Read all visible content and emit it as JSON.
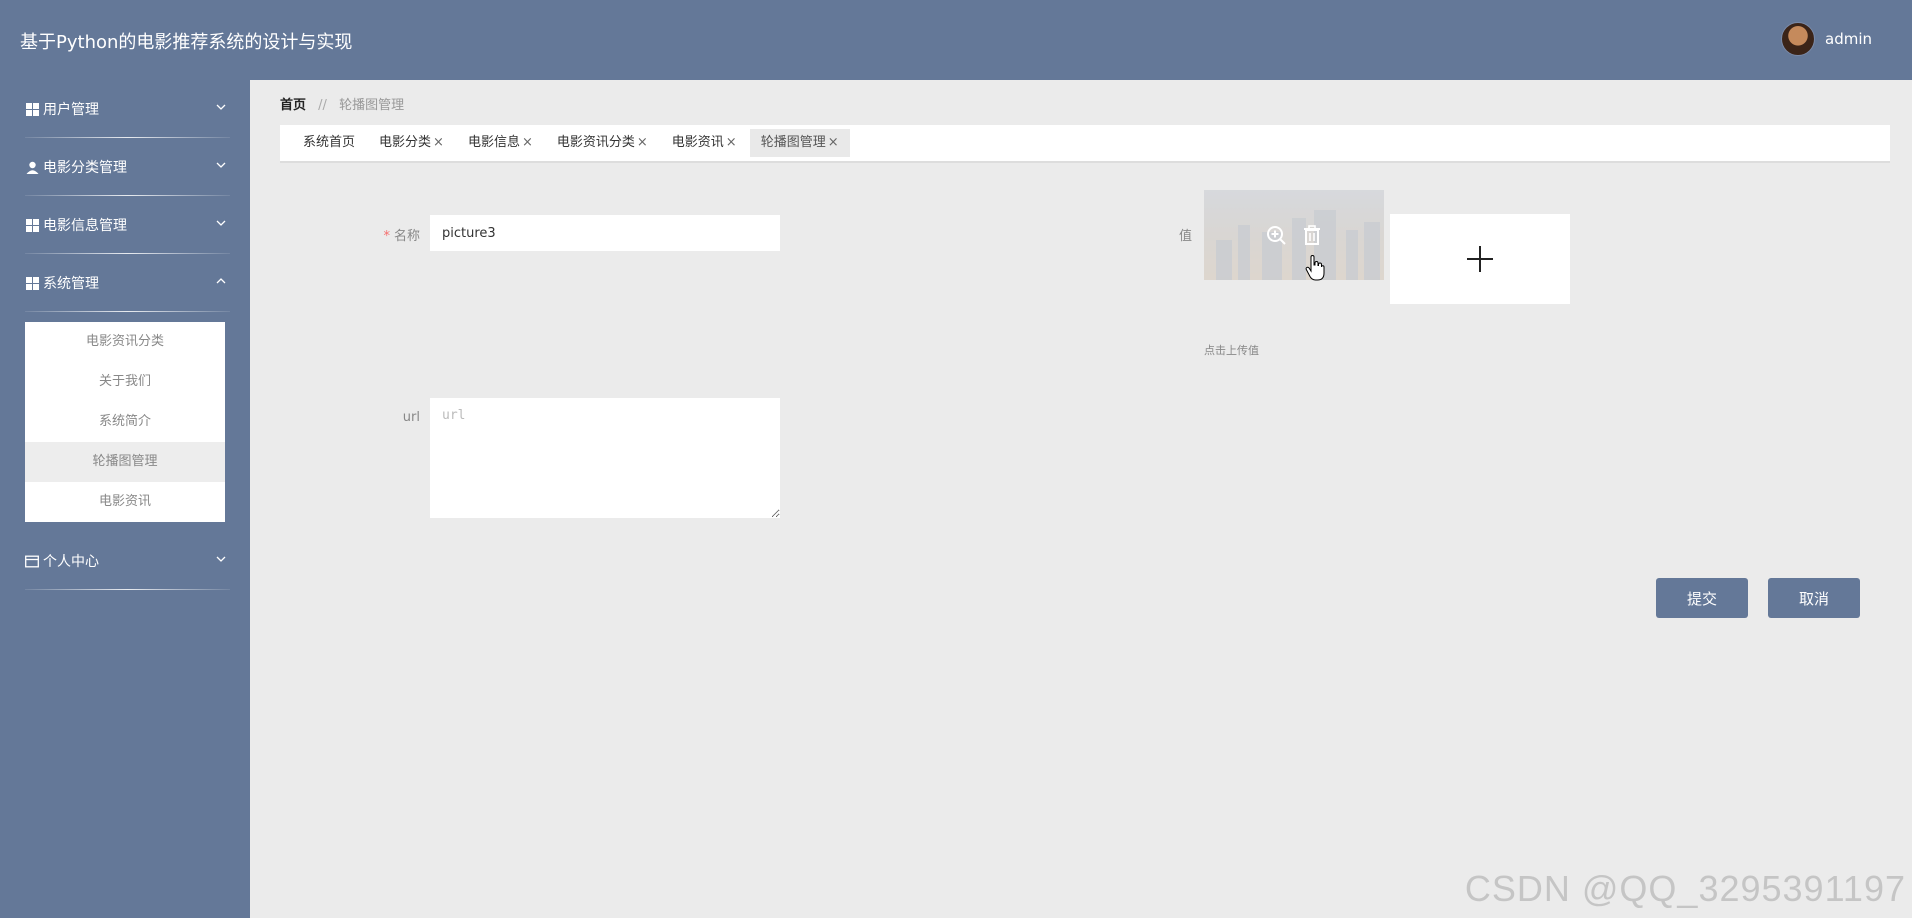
{
  "header": {
    "title": "基于Python的电影推荐系统的设计与实现",
    "username": "admin"
  },
  "sidebar": {
    "groups": [
      {
        "label": "用户管理",
        "icon": "grid-icon",
        "expanded": false
      },
      {
        "label": "电影分类管理",
        "icon": "user-icon",
        "expanded": false
      },
      {
        "label": "电影信息管理",
        "icon": "grid-icon",
        "expanded": false
      },
      {
        "label": "系统管理",
        "icon": "grid-icon",
        "expanded": true,
        "items": [
          "电影资讯分类",
          "关于我们",
          "系统简介",
          "轮播图管理",
          "电影资讯"
        ],
        "active_item": "轮播图管理"
      },
      {
        "label": "个人中心",
        "icon": "card-icon",
        "expanded": false
      }
    ]
  },
  "breadcrumb": {
    "home": "首页",
    "separator": "//",
    "current": "轮播图管理"
  },
  "tabs": [
    {
      "label": "系统首页",
      "closable": false
    },
    {
      "label": "电影分类",
      "closable": true
    },
    {
      "label": "电影信息",
      "closable": true
    },
    {
      "label": "电影资讯分类",
      "closable": true
    },
    {
      "label": "电影资讯",
      "closable": true
    },
    {
      "label": "轮播图管理",
      "closable": true,
      "active": true
    }
  ],
  "tab_close_glyph": "×",
  "form": {
    "name_label": "名称",
    "name_required_mark": "*",
    "name_value": "picture3",
    "value_label": "值",
    "upload_hint": "点击上传值",
    "url_label": "url",
    "url_placeholder": "url",
    "url_value": ""
  },
  "buttons": {
    "submit": "提交",
    "cancel": "取消"
  },
  "watermark": "CSDN @QQ_3295391197",
  "colors": {
    "primary": "#647898",
    "background": "#ebebeb",
    "required": "#f56c6c"
  }
}
